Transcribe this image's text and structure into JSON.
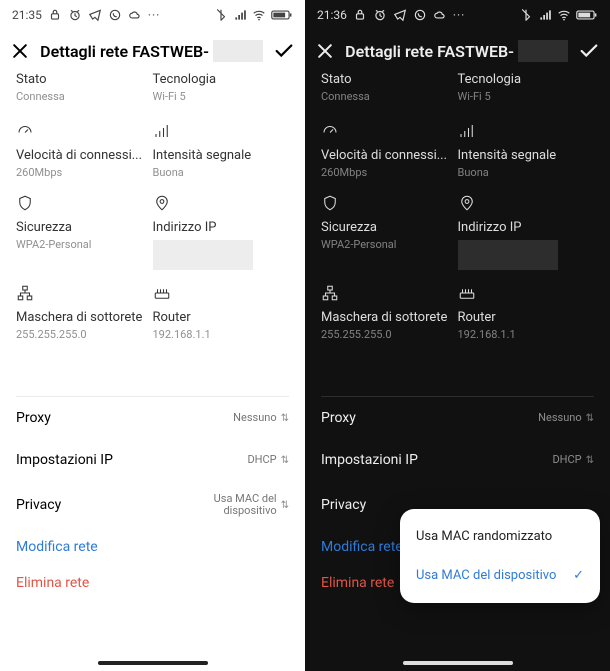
{
  "left": {
    "status": {
      "time": "21:35"
    },
    "title_prefix": "Dettagli rete FASTWEB-",
    "stato": {
      "label": "Stato",
      "value": "Connessa"
    },
    "tech": {
      "label": "Tecnologia",
      "value": "Wi-Fi 5"
    },
    "speed": {
      "label": "Velocità di connessi...",
      "value": "260Mbps"
    },
    "signal": {
      "label": "Intensità segnale",
      "value": "Buona"
    },
    "security": {
      "label": "Sicurezza",
      "value": "WPA2-Personal"
    },
    "ip": {
      "label": "Indirizzo IP"
    },
    "mask": {
      "label": "Maschera di sottorete",
      "value": "255.255.255.0"
    },
    "router": {
      "label": "Router",
      "value": "192.168.1.1"
    },
    "proxy": {
      "label": "Proxy",
      "value": "Nessuno"
    },
    "ipset": {
      "label": "Impostazioni IP",
      "value": "DHCP"
    },
    "privacy": {
      "label": "Privacy",
      "value": "Usa MAC del\ndispositivo"
    },
    "modify": "Modifica rete",
    "delete": "Elimina rete"
  },
  "right": {
    "status": {
      "time": "21:36"
    },
    "title_prefix": "Dettagli rete FASTWEB-",
    "stato": {
      "label": "Stato",
      "value": "Connessa"
    },
    "tech": {
      "label": "Tecnologia",
      "value": "Wi-Fi 5"
    },
    "speed": {
      "label": "Velocità di connessi...",
      "value": "260Mbps"
    },
    "signal": {
      "label": "Intensità segnale",
      "value": "Buona"
    },
    "security": {
      "label": "Sicurezza",
      "value": "WPA2-Personal"
    },
    "ip": {
      "label": "Indirizzo IP"
    },
    "mask": {
      "label": "Maschera di sottorete",
      "value": "255.255.255.0"
    },
    "router": {
      "label": "Router",
      "value": "192.168.1.1"
    },
    "proxy": {
      "label": "Proxy",
      "value": "Nessuno"
    },
    "ipset": {
      "label": "Impostazioni IP",
      "value": "DHCP"
    },
    "privacy": {
      "label": "Privacy"
    },
    "modify": "Modifica rete",
    "delete": "Elimina rete",
    "popup": {
      "opt1": "Usa MAC randomizzato",
      "opt2": "Usa MAC del dispositivo"
    }
  }
}
